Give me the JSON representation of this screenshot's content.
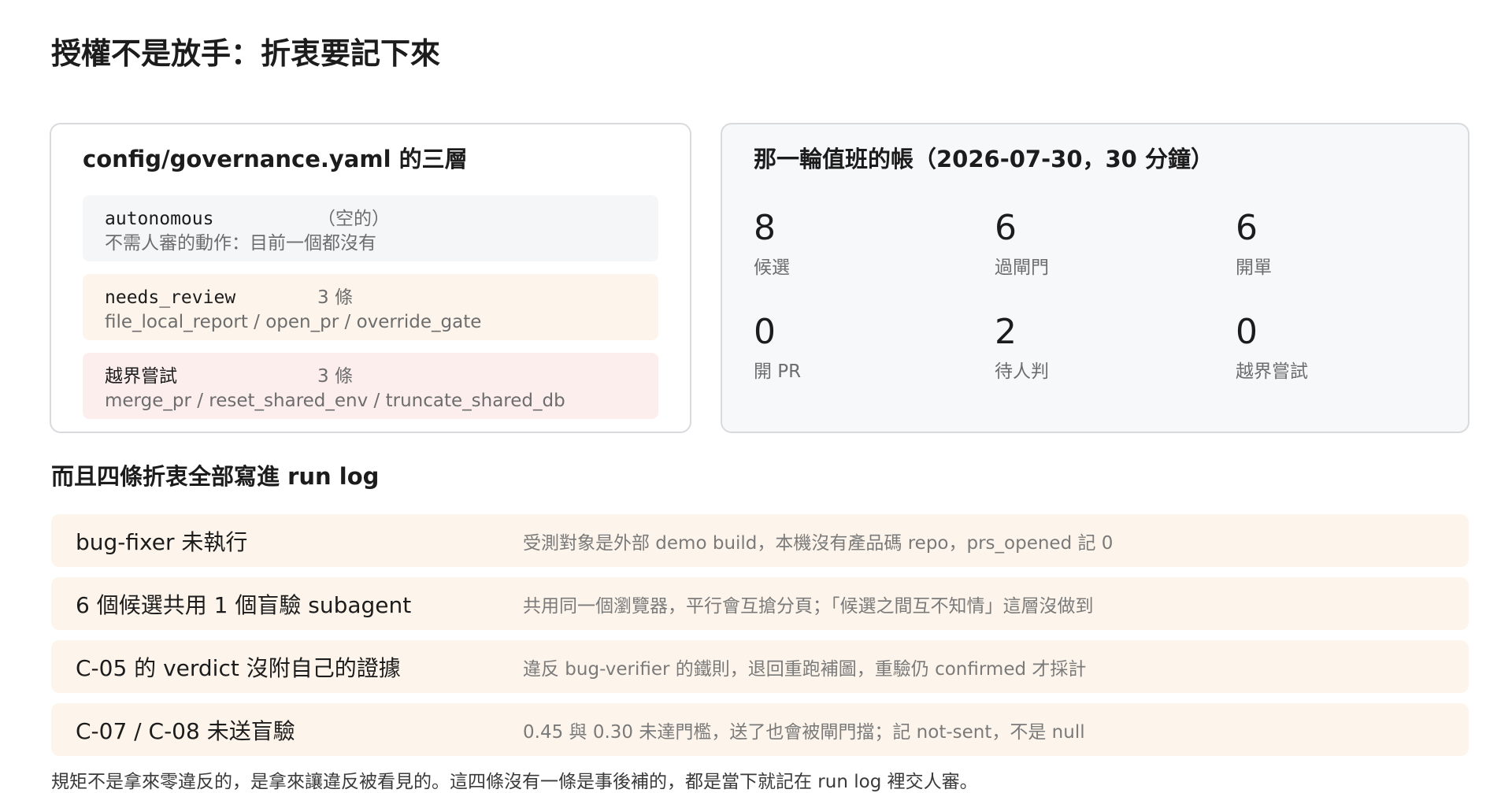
{
  "page_title": "授權不是放手：折衷要記下來",
  "governance": {
    "title": "config/governance.yaml 的三層",
    "tiers": [
      {
        "name": "autonomous",
        "count": "（空的）",
        "desc": "不需人審的動作：目前一個都沒有"
      },
      {
        "name": "needs_review",
        "count": "3 條",
        "desc": "file_local_report / open_pr / override_gate"
      },
      {
        "name": "越界嘗試",
        "count": "3 條",
        "desc": "merge_pr / reset_shared_env / truncate_shared_db"
      }
    ]
  },
  "shift": {
    "title": "那一輪值班的帳（2026-07-30，30 分鐘）",
    "stats": [
      {
        "value": "8",
        "label": "候選"
      },
      {
        "value": "6",
        "label": "過閘門"
      },
      {
        "value": "6",
        "label": "開單"
      },
      {
        "value": "0",
        "label": "開 PR"
      },
      {
        "value": "2",
        "label": "待人判"
      },
      {
        "value": "0",
        "label": "越界嘗試"
      }
    ]
  },
  "runlog": {
    "title": "而且四條折衷全部寫進 run log",
    "items": [
      {
        "title": "bug-fixer 未執行",
        "detail": "受測對象是外部 demo build，本機沒有產品碼 repo，prs_opened 記 0"
      },
      {
        "title": "6 個候選共用 1 個盲驗 subagent",
        "detail": "共用同一個瀏覽器，平行會互搶分頁；「候選之間互不知情」這層沒做到"
      },
      {
        "title": "C-05 的 verdict 沒附自己的證據",
        "detail": "違反 bug-verifier 的鐵則，退回重跑補圖，重驗仍 confirmed 才採計"
      },
      {
        "title": "C-07 / C-08 未送盲驗",
        "detail": "0.45 與 0.30 未達門檻，送了也會被閘門擋；記 not-sent，不是 null"
      }
    ]
  },
  "footnote": "規矩不是拿來零違反的，是拿來讓違反被看見的。這四條沒有一條是事後補的，都是當下就記在 run log 裡交人審。"
}
